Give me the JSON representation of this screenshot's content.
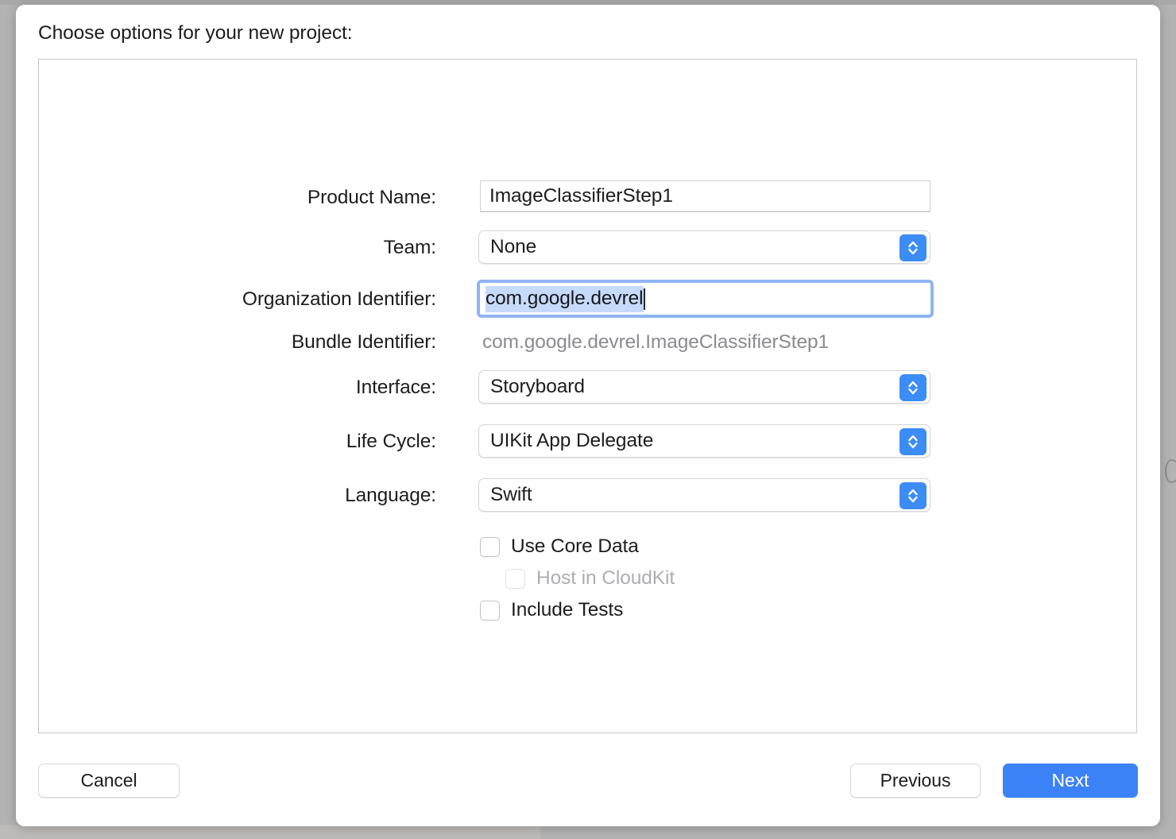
{
  "dialog": {
    "title": "Choose options for your new project:"
  },
  "form": {
    "rows": [
      {
        "label": "Product Name:",
        "value": "ImageClassifierStep1",
        "type": "text"
      },
      {
        "label": "Team:",
        "value": "None",
        "type": "popup"
      },
      {
        "label": "Organization Identifier:",
        "value": "com.google.devrel",
        "type": "text-focused"
      },
      {
        "label": "Bundle Identifier:",
        "value": "com.google.devrel.ImageClassifierStep1",
        "type": "static"
      },
      {
        "label": "Interface:",
        "value": "Storyboard",
        "type": "popup"
      },
      {
        "label": "Life Cycle:",
        "value": "UIKit App Delegate",
        "type": "popup"
      },
      {
        "label": "Language:",
        "value": "Swift",
        "type": "popup"
      }
    ],
    "checkboxes": [
      {
        "label": "Use Core Data",
        "checked": false,
        "disabled": false
      },
      {
        "label": "Host in CloudKit",
        "checked": false,
        "disabled": true
      },
      {
        "label": "Include Tests",
        "checked": false,
        "disabled": false
      }
    ]
  },
  "footer": {
    "cancel_label": "Cancel",
    "previous_label": "Previous",
    "next_label": "Next"
  },
  "colors": {
    "accent": "#3b82f6",
    "stepper": "#3c8cf6",
    "focus_ring": "#8fb4f2",
    "selection": "#c6dafb",
    "disabled_text": "#aeaeb2",
    "static_text": "#8b8b8f"
  }
}
